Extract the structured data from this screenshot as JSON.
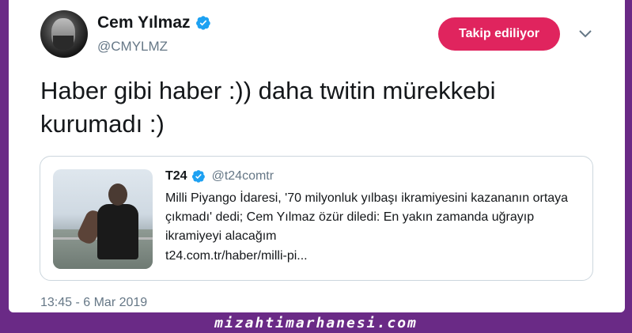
{
  "profile": {
    "name": "Cem Yılmaz",
    "handle": "@CMYLMZ",
    "verified_icon": "verified-badge-icon",
    "avatar_icon": "avatar"
  },
  "actions": {
    "follow_label": "Takip ediliyor",
    "menu_icon": "chevron-down-icon"
  },
  "tweet": {
    "text": "Haber gibi haber :)) daha twitin mürekkebi kurumadı :)",
    "timestamp": "13:45 - 6 Mar 2019"
  },
  "quoted_tweet": {
    "name": "T24",
    "handle": "@t24comtr",
    "text": "Milli Piyango İdaresi, '70 milyonluk yılbaşı ikramiyesini kazananın ortaya çıkmadı' dedi; Cem Yılmaz özür diledi: En yakın zamanda uğrayıp ikramiyeyi alacağım",
    "link": "t24.com.tr/haber/milli-pi..."
  },
  "watermark": "mizahtimarhanesi.com",
  "colors": {
    "background": "#6a2a86",
    "follow_button": "#e0245e",
    "verified": "#1da1f2",
    "secondary_text": "#657786"
  }
}
